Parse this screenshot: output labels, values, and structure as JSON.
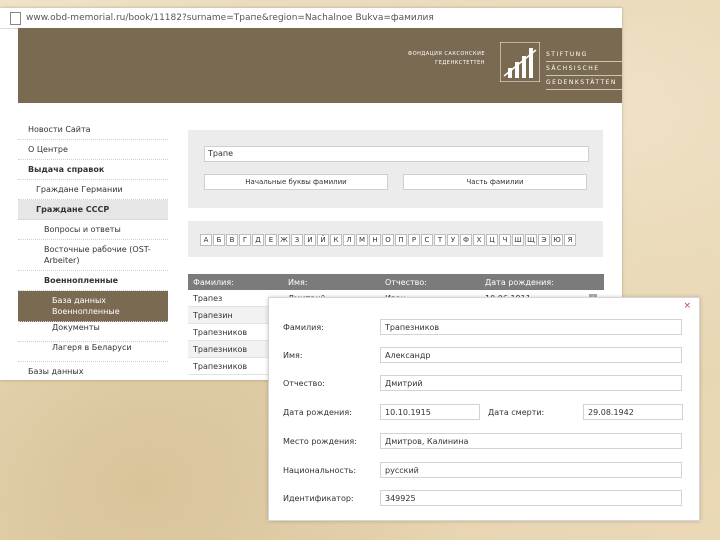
{
  "browser": {
    "url": "www.obd-memorial.ru/book/11182?surname=Трапе&region=Nachalnoe Bukva=фамилия"
  },
  "brand": {
    "line1": "ФОНДАЦИЯ САКСОНСКИЕ",
    "line2": "ГЕДЕНКСТЕТТЕН",
    "logo": [
      "STIFTUNG",
      "SÄCHSISCHE",
      "GEDENKSTÄTTEN"
    ]
  },
  "sidebar": {
    "items": [
      "Новости Сайта",
      "О Центре",
      "Выдача справок",
      "Граждане Германии",
      "Граждане СССР",
      "Вопросы и ответы",
      "Восточные рабочие (OST-Arbeiter)",
      "Военнопленные",
      "База данных Военнопленные",
      "Документы",
      "Лагеря в Беларуси",
      "Базы данных"
    ]
  },
  "search": {
    "value": "Трапе",
    "btn_begin": "Начальные буквы фамилии",
    "btn_part": "Часть фамилии",
    "alphabet": [
      "А",
      "Б",
      "В",
      "Г",
      "Д",
      "Е",
      "Ж",
      "З",
      "И",
      "Й",
      "К",
      "Л",
      "М",
      "Н",
      "О",
      "П",
      "Р",
      "С",
      "Т",
      "У",
      "Ф",
      "Х",
      "Ц",
      "Ч",
      "Ш",
      "Щ",
      "Э",
      "Ю",
      "Я"
    ]
  },
  "results": {
    "headers": [
      "Фамилия:",
      "Имя:",
      "Отчество:",
      "Дата рождения:"
    ],
    "rows": [
      [
        "Трапез",
        "Дмитрий",
        "Иван",
        "10.06.1911"
      ],
      [
        "Трапезин",
        "",
        "",
        ""
      ],
      [
        "Трапезников",
        "",
        "",
        ""
      ],
      [
        "Трапезников",
        "",
        "",
        ""
      ],
      [
        "Трапезников",
        "",
        "",
        ""
      ]
    ]
  },
  "detail": {
    "close": "×",
    "labels": {
      "surname": "Фамилия:",
      "name": "Имя:",
      "patronymic": "Отчество:",
      "birth": "Дата рождения:",
      "death": "Дата смерти:",
      "birthplace": "Место рождения:",
      "nationality": "Национальность:",
      "id": "Идентификатор:"
    },
    "values": {
      "surname": "Трапезников",
      "name": "Александр",
      "patronymic": "Дмитрий",
      "birth": "10.10.1915",
      "death": "29.08.1942",
      "birthplace": "Дмитров, Калинина",
      "nationality": "русский",
      "id": "349925"
    }
  },
  "colors": {
    "brand": "#7a6a52",
    "table_head": "#7b7b7b",
    "panel": "#ececec"
  }
}
